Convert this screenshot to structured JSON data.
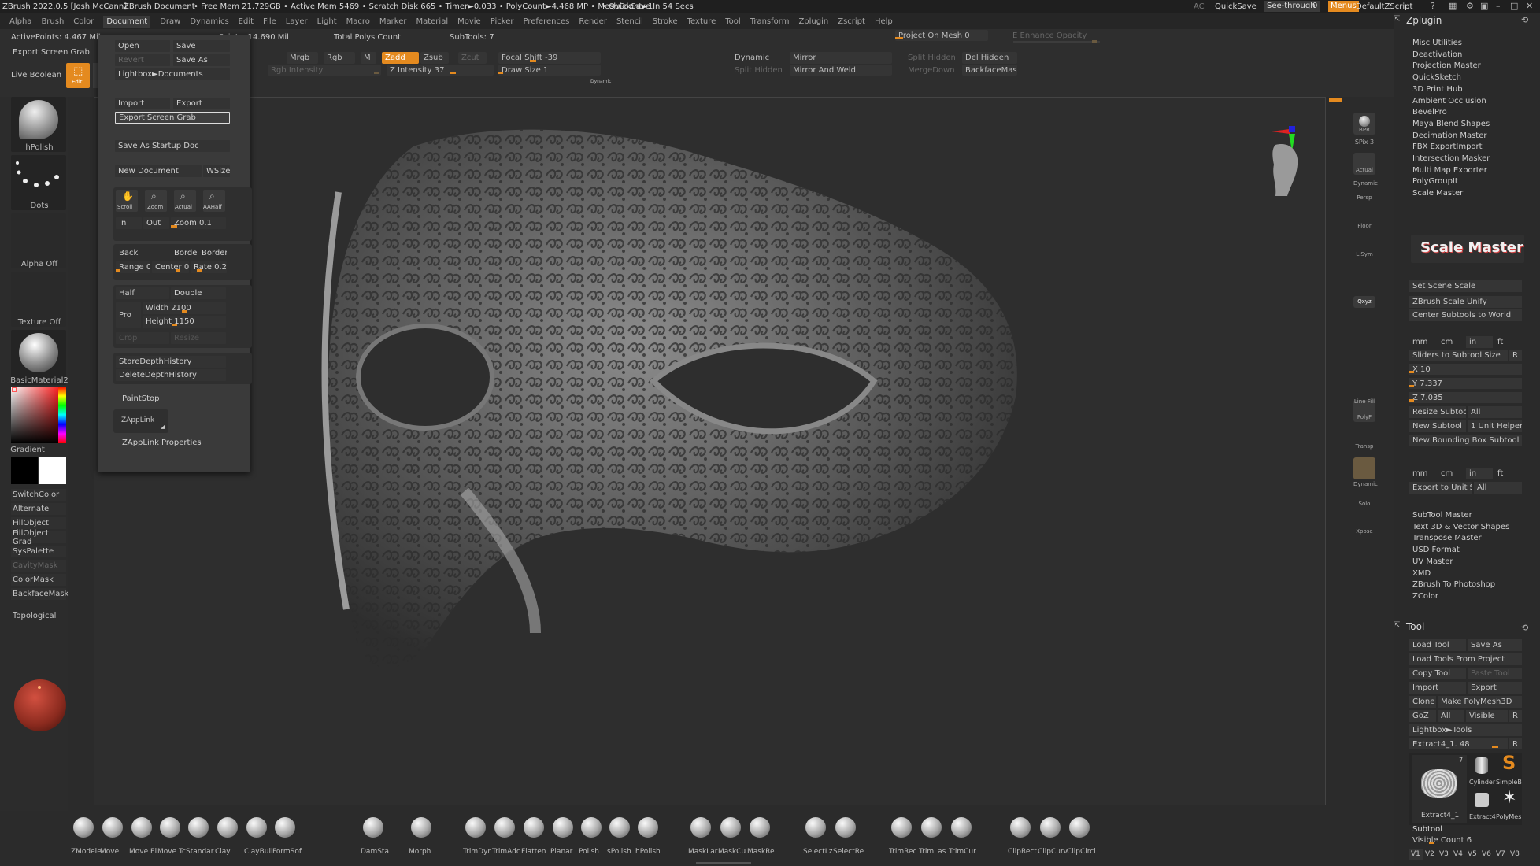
{
  "titlebar": {
    "app": "ZBrush 2022.0.5 [Josh McCann]",
    "doc": "ZBrush Document",
    "stats": "• Free Mem 21.729GB • Active Mem 5469 • Scratch Disk 665 • Timer►0.033 • PolyCount►4.468 MP • MeshCount►1",
    "quicksave_status": "• QuickSave In 54 Secs",
    "ac": "AC",
    "quicksave": "QuickSave",
    "seethrough": "See-through",
    "seethrough_val": "0",
    "menus": "Menus",
    "script": "DefaultZScript"
  },
  "menubar": [
    "Alpha",
    "Brush",
    "Color",
    "Document",
    "Draw",
    "Dynamics",
    "Edit",
    "File",
    "Layer",
    "Light",
    "Macro",
    "Marker",
    "Material",
    "Movie",
    "Picker",
    "Preferences",
    "Render",
    "Stencil",
    "Stroke",
    "Texture",
    "Tool",
    "Transform",
    "Zplugin",
    "Zscript",
    "Help"
  ],
  "shelf": {
    "active_points": "ActivePoints: 4.467 Mil",
    "total_points": "Points: 14.690 Mil",
    "total_polys": "Total Polys Count",
    "subtools": "SubTools: 7",
    "project_on_mesh": "Project On Mesh 0",
    "enhance_opacity": "E Enhance Opacity",
    "export_screen_grab": "Export Screen Grab",
    "live_boolean": "Live Boolean",
    "edit": "Edit",
    "mrgb": "Mrgb",
    "rgb": "Rgb",
    "m": "M",
    "zadd": "Zadd",
    "zsub": "Zsub",
    "zcut": "Zcut",
    "rgb_intensity": "Rgb Intensity",
    "z_intensity": "Z Intensity 37",
    "focal_shift": "Focal Shift -39",
    "draw_size": "Draw Size 1",
    "dynamic_small": "Dynamic",
    "dynamic": "Dynamic",
    "mirror": "Mirror",
    "split_hidden_top": "Split Hidden",
    "del_hidden": "Del Hidden",
    "split_hidden": "Split Hidden",
    "mirror_weld": "Mirror And Weld",
    "merge_down": "MergeDown",
    "backface_mask": "BackfaceMask"
  },
  "left": {
    "brush": "hPolish",
    "stroke": "Dots",
    "alpha": "Alpha Off",
    "texture": "Texture Off",
    "material": "BasicMaterial2",
    "gradient": "Gradient",
    "switch_color": "SwitchColor",
    "alternate": "Alternate",
    "fill_object": "FillObject",
    "fill_object_grad": "FillObject Grad",
    "sys_palette": "SysPalette",
    "cavity_mask": "CavityMask",
    "color_mask": "ColorMask",
    "backface_mask": "BackfaceMask",
    "topological": "Topological"
  },
  "docmenu": {
    "open": "Open",
    "save": "Save",
    "revert": "Revert",
    "save_as": "Save As",
    "lightbox": "Lightbox►Documents",
    "import": "Import",
    "export": "Export",
    "export_screen_grab": "Export Screen Grab",
    "save_startup": "Save As Startup Doc",
    "new_document": "New Document",
    "wsize": "WSize",
    "scroll": "Scroll",
    "zoom": "Zoom",
    "actual": "Actual",
    "aahalf": "AAHalf",
    "in": "In",
    "out": "Out",
    "zoom_val": "Zoom 0.1",
    "back": "Back",
    "border": "Border",
    "border2": "Border2",
    "range": "Range 0",
    "center": "Center 0.7",
    "rate": "Rate 0.25",
    "half": "Half",
    "double": "Double",
    "pro": "Pro",
    "width": "Width 2100",
    "height": "Height 1150",
    "crop": "Crop",
    "resize": "Resize",
    "store_depth": "StoreDepthHistory",
    "delete_depth": "DeleteDepthHistory",
    "paintstop": "PaintStop",
    "zapplink": "ZAppLink",
    "zapplink_props": "ZAppLink Properties"
  },
  "righttools": {
    "bpr": "BPR",
    "spix": "SPix 3",
    "actual": "Actual",
    "dynamic": "Dynamic",
    "persp": "Persp",
    "floor": "Floor",
    "lsym": "L.Sym",
    "xyz": "Qxyz",
    "linefill": "Line Fill",
    "polyf": "PolyF",
    "transp": "Transp",
    "dynamic2": "Dynamic",
    "solo": "Solo",
    "xpose": "Xpose"
  },
  "zplugin": {
    "title": "Zplugin",
    "items": [
      "Misc Utilities",
      "Deactivation",
      "Projection Master",
      "QuickSketch",
      "3D Print Hub",
      "Ambient Occlusion",
      "BevelPro",
      "Maya Blend Shapes",
      "Decimation Master",
      "FBX ExportImport",
      "Intersection Masker",
      "Multi Map Exporter",
      "PolyGroupIt",
      "Scale Master"
    ],
    "scale_master_logo": "Scale Master",
    "set_scene_scale": "Set Scene Scale",
    "scale_unify": "ZBrush Scale Unify",
    "center_subtools": "Center Subtools to World",
    "units": [
      "mm",
      "cm",
      "in",
      "ft"
    ],
    "sliders_size": "Sliders to Subtool Size",
    "r": "R",
    "x": "X 10",
    "y": "Y 7.337",
    "z": "Z 7.035",
    "resize_subtool": "Resize Subtool",
    "all": "All",
    "new_subtool": "New Subtool",
    "unit_helper": "1 Unit Helper",
    "new_bbox": "New Bounding Box Subtool",
    "export_unit": "Export to Unit Scale",
    "items2": [
      "SubTool Master",
      "Text 3D & Vector Shapes",
      "Transpose Master",
      "USD Format",
      "UV Master",
      "XMD",
      "ZBrush To Photoshop",
      "ZColor"
    ]
  },
  "tool": {
    "title": "Tool",
    "load_tool": "Load Tool",
    "save_as": "Save As",
    "load_from_project": "Load Tools From Project",
    "copy_tool": "Copy Tool",
    "paste_tool": "Paste Tool",
    "import": "Import",
    "export": "Export",
    "clone": "Clone",
    "make_polymesh": "Make PolyMesh3D",
    "goz": "GoZ",
    "all": "All",
    "visible": "Visible",
    "r": "R",
    "lightbox_tools": "Lightbox►Tools",
    "extract_slider": "Extract4_1. 48",
    "thumb_main": "Extract4_1",
    "thumb_count": "7",
    "cylinder": "Cylinder",
    "simpleb": "SimpleB",
    "extract4": "Extract4",
    "polymesh": "PolyMes",
    "subtool": "Subtool",
    "visible_count": "Visible Count 6",
    "v_tabs": [
      "V1",
      "V2",
      "V3",
      "V4",
      "V5",
      "V6",
      "V7",
      "V8"
    ]
  },
  "brushes": [
    {
      "label": "ZModele"
    },
    {
      "label": "Move"
    },
    {
      "label": "Move El"
    },
    {
      "label": "Move Tc"
    },
    {
      "label": "Standar"
    },
    {
      "label": "Clay"
    },
    {
      "label": "ClayBuil"
    },
    {
      "label": "FormSof"
    },
    {
      "label": "DamSta"
    },
    {
      "label": "Morph"
    },
    {
      "label": "TrimDyr"
    },
    {
      "label": "TrimAdc"
    },
    {
      "label": "Flatten"
    },
    {
      "label": "Planar"
    },
    {
      "label": "Polish"
    },
    {
      "label": "sPolish"
    },
    {
      "label": "hPolish"
    },
    {
      "label": "MaskLar"
    },
    {
      "label": "MaskCu"
    },
    {
      "label": "MaskRe"
    },
    {
      "label": "SelectLz"
    },
    {
      "label": "SelectRe"
    },
    {
      "label": "TrimRec"
    },
    {
      "label": "TrimLas"
    },
    {
      "label": "TrimCur"
    },
    {
      "label": "ClipRect"
    },
    {
      "label": "ClipCurv"
    },
    {
      "label": "ClipCircl"
    }
  ]
}
